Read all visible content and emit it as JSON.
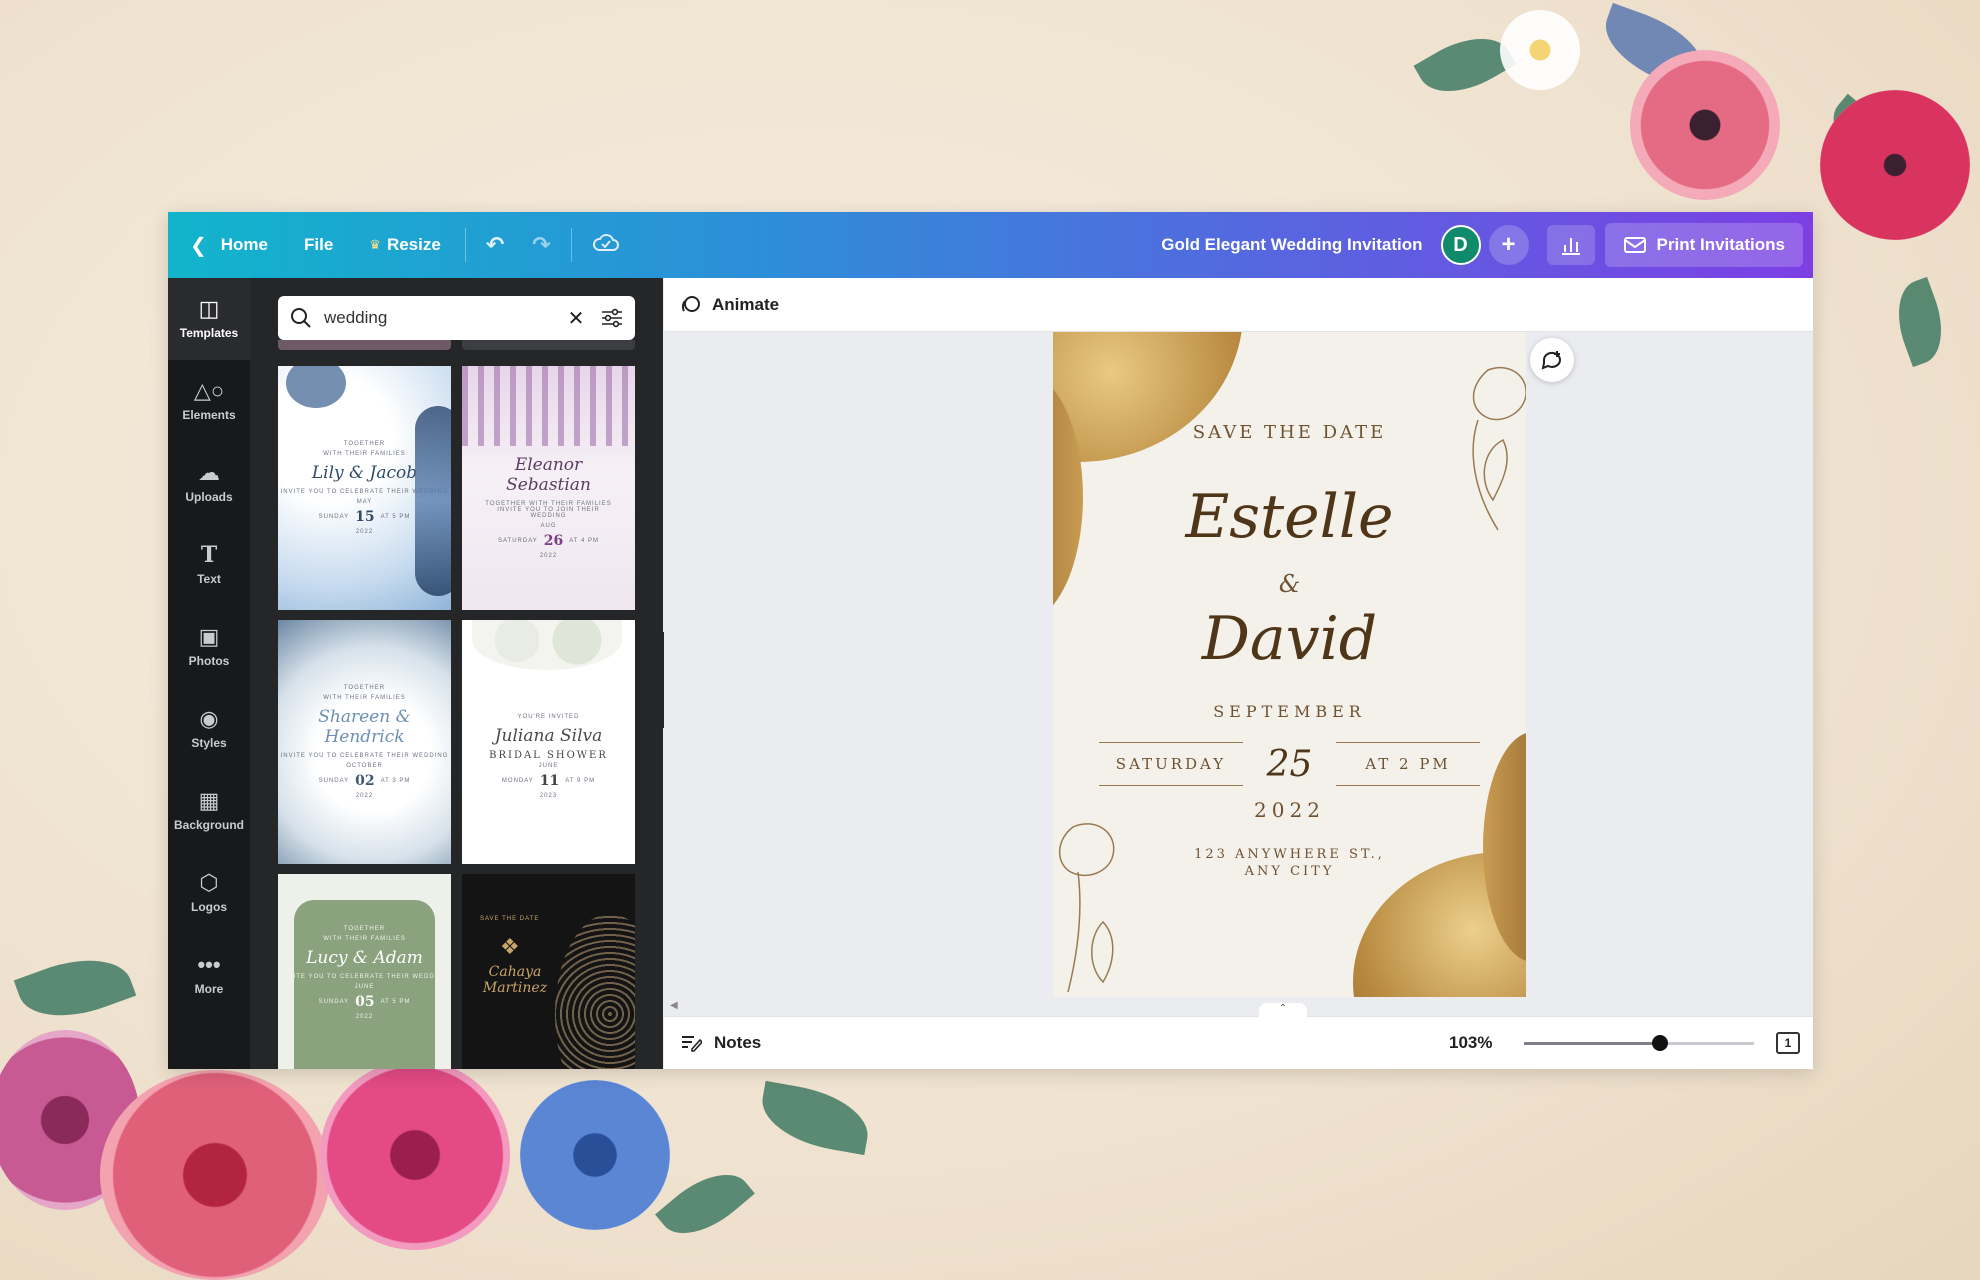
{
  "topbar": {
    "home_label": "Home",
    "file_label": "File",
    "resize_label": "Resize",
    "doc_title": "Gold Elegant Wedding Invitation",
    "avatar_initial": "D",
    "print_label": "Print Invitations"
  },
  "rail": {
    "items": [
      {
        "label": "Templates",
        "icon": "template-icon"
      },
      {
        "label": "Elements",
        "icon": "shapes-icon"
      },
      {
        "label": "Uploads",
        "icon": "cloud-upload-icon"
      },
      {
        "label": "Text",
        "icon": "text-icon"
      },
      {
        "label": "Photos",
        "icon": "image-icon"
      },
      {
        "label": "Styles",
        "icon": "palette-icon"
      },
      {
        "label": "Background",
        "icon": "background-icon"
      },
      {
        "label": "Logos",
        "icon": "logo-icon"
      },
      {
        "label": "More",
        "icon": "dots-icon"
      }
    ]
  },
  "search": {
    "value": "wedding"
  },
  "templates": [
    {
      "top": "TOGETHER",
      "sub": "WITH THEIR FAMILIES",
      "names": "Lily & Jacob",
      "invite": "INVITE YOU TO CELEBRATE THEIR WEDDING",
      "month": "MAY",
      "day": "15",
      "left": "SUNDAY",
      "right": "AT 5 PM",
      "year": "2022",
      "bg": "#dce9f3",
      "ink": "#2f4a6b"
    },
    {
      "top": "",
      "sub": "",
      "names": "Eleanor Sebastian",
      "invite": "TOGETHER WITH THEIR FAMILIES INVITE YOU TO JOIN THEIR WEDDING",
      "month": "AUG",
      "day": "26",
      "left": "SATURDAY",
      "right": "AT 4 PM",
      "year": "2022",
      "bg": "#f3eef4",
      "ink": "#5b3c61"
    },
    {
      "top": "TOGETHER",
      "sub": "WITH THEIR FAMILIES",
      "names": "Shareen & Hendrick",
      "invite": "INVITE YOU TO CELEBRATE THEIR WEDDING",
      "month": "OCTOBER",
      "day": "02",
      "left": "SUNDAY",
      "right": "AT 3 PM",
      "year": "2022",
      "bg": "#e7edf2",
      "ink": "#3c5873"
    },
    {
      "top": "YOU'RE INVITED",
      "sub": "",
      "names": "Juliana Silva",
      "invite": "BRIDAL SHOWER",
      "month": "JUNE",
      "day": "11",
      "left": "MONDAY",
      "right": "AT 9 PM",
      "year": "2023",
      "bg": "#ffffff",
      "ink": "#4a4a4a"
    },
    {
      "top": "TOGETHER",
      "sub": "WITH THEIR FAMILIES",
      "names": "Lucy & Adam",
      "invite": "INVITE YOU TO CELEBRATE THEIR WEDDING",
      "month": "JUNE",
      "day": "05",
      "left": "SUNDAY",
      "right": "AT 5 PM",
      "year": "2022",
      "bg": "#8aa27e",
      "ink": "#ffffff"
    },
    {
      "top": "SAVE THE DATE",
      "sub": "",
      "names": "Cahaya Martinez",
      "invite": "",
      "month": "",
      "day": "",
      "left": "",
      "right": "",
      "year": "",
      "bg": "#141414",
      "ink": "#c9a46a"
    }
  ],
  "workspace": {
    "animate_label": "Animate",
    "notes_label": "Notes",
    "zoom": "103%",
    "zoom_fraction": 0.59,
    "page_count": "1"
  },
  "invitation": {
    "header": "SAVE THE DATE",
    "name1": "Estelle",
    "amp": "&",
    "name2": "David",
    "month": "SEPTEMBER",
    "weekday": "SATURDAY",
    "day": "25",
    "time": "AT 2 PM",
    "year": "2022",
    "address1": "123 ANYWHERE ST.,",
    "address2": "ANY CITY"
  },
  "colors": {
    "gold": "#b8893f",
    "panel": "#252628",
    "rail": "#18191b"
  }
}
